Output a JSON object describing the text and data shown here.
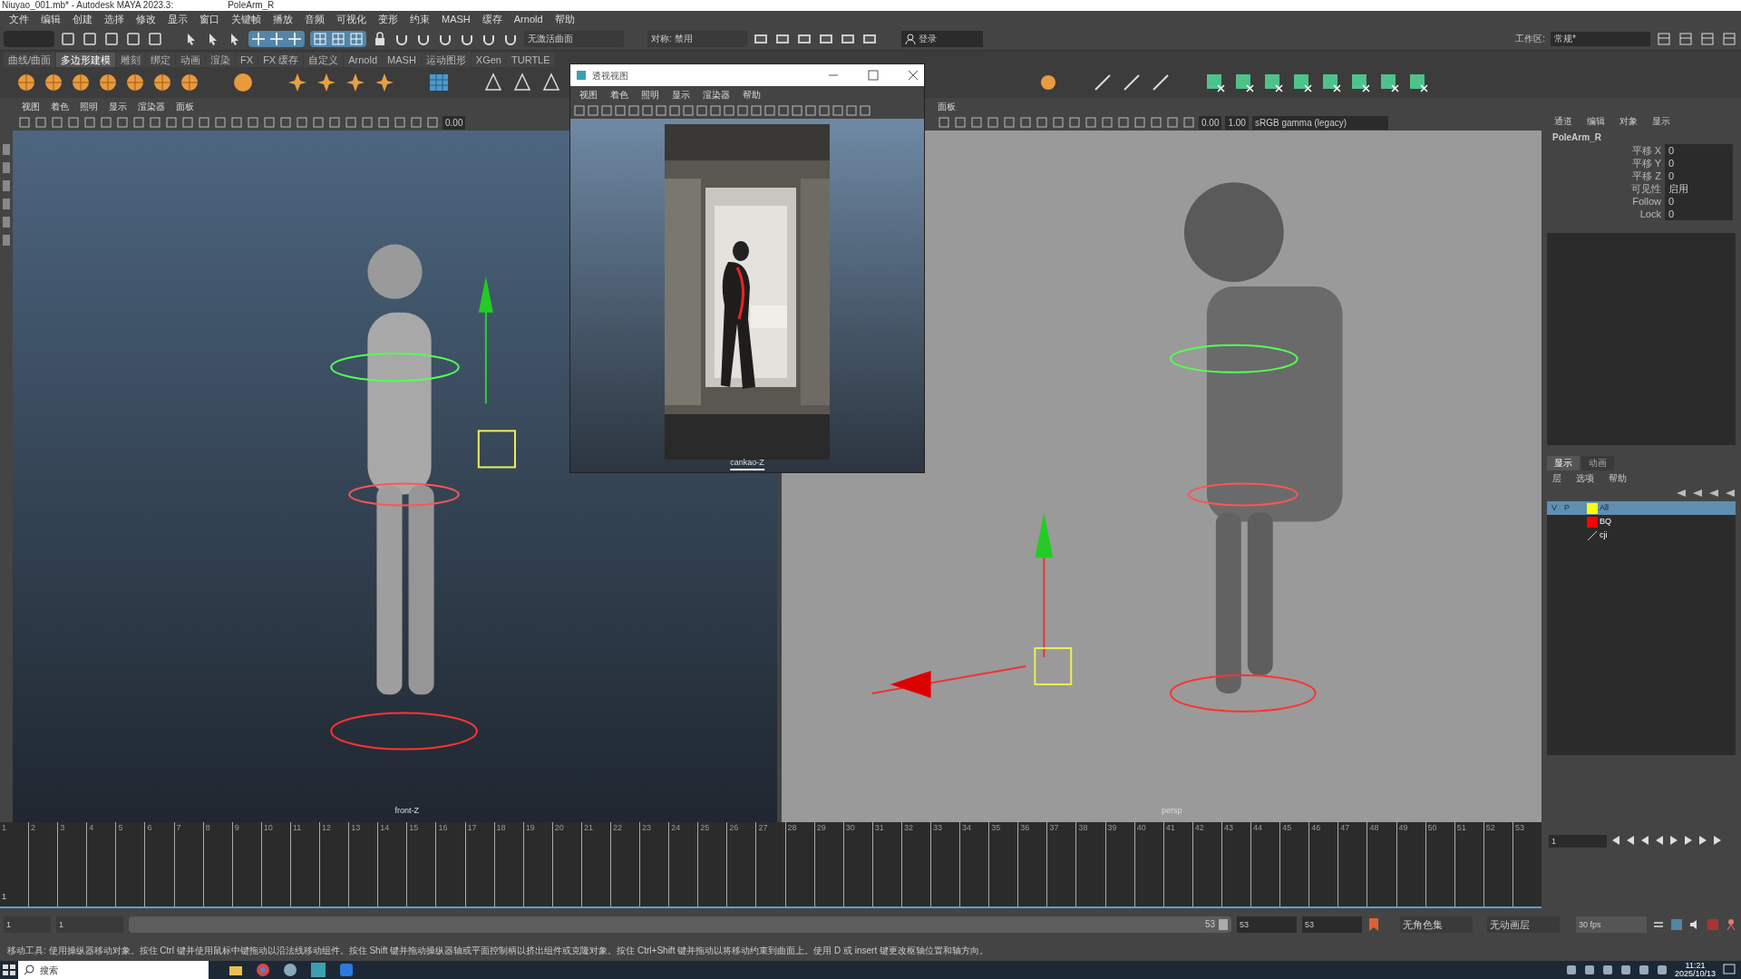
{
  "window": {
    "title": "Niuyao_001.mb* - Autodesk MAYA 2023.3:",
    "active_object": "PoleArm_R"
  },
  "menu": [
    "文件",
    "编辑",
    "创建",
    "选择",
    "修改",
    "显示",
    "窗口",
    "关键帧",
    "播放",
    "音频",
    "可视化",
    "变形",
    "约束",
    "MASH",
    "缓存",
    "Arnold",
    "帮助"
  ],
  "status_line": {
    "surface": "无激活曲面",
    "symmetry": "对称: 禁用",
    "login": "登录",
    "workspace_label": "工作区:",
    "workspace": "常规*"
  },
  "shelf_tabs": [
    {
      "label": "曲线/曲面",
      "selected": false
    },
    {
      "label": "多边形建模",
      "selected": true
    },
    {
      "label": "雕刻",
      "selected": false
    },
    {
      "label": "绑定",
      "selected": false
    },
    {
      "label": "动画",
      "selected": false
    },
    {
      "label": "渲染",
      "selected": false
    },
    {
      "label": "FX",
      "selected": false
    },
    {
      "label": "FX 缓存",
      "selected": false
    },
    {
      "label": "自定义",
      "selected": false
    },
    {
      "label": "Arnold",
      "selected": false
    },
    {
      "label": "MASH",
      "selected": false
    },
    {
      "label": "运动图形",
      "selected": false
    },
    {
      "label": "XGen",
      "selected": false
    },
    {
      "label": "TURTLE",
      "selected": false
    }
  ],
  "viewports": [
    {
      "menu": [
        "视图",
        "着色",
        "照明",
        "显示",
        "渲染器",
        "面板"
      ],
      "exposure": "0.00",
      "camera": "front-Z"
    },
    {
      "menu": [
        "面板"
      ],
      "exposure": "0.00",
      "gamma": "1.00",
      "color_space": "sRGB gamma (legacy)",
      "camera": "persp"
    }
  ],
  "floating_window": {
    "title": "透视视图",
    "menu": [
      "视图",
      "着色",
      "照明",
      "显示",
      "渲染器",
      "帮助"
    ],
    "camera": "cankao-Z"
  },
  "channel_box": {
    "menu": [
      "通道",
      "编辑",
      "对象",
      "显示"
    ],
    "object": "PoleArm_R",
    "attributes": [
      {
        "name": "平移 X",
        "value": "0"
      },
      {
        "name": "平移 Y",
        "value": "0"
      },
      {
        "name": "平移 Z",
        "value": "0"
      },
      {
        "name": "可见性",
        "value": "启用"
      },
      {
        "name": "Follow",
        "value": "0"
      },
      {
        "name": "Lock",
        "value": "0"
      }
    ]
  },
  "layer_editor": {
    "tabs": [
      {
        "label": "显示",
        "selected": true
      },
      {
        "label": "动画",
        "selected": false
      }
    ],
    "menu": [
      "层",
      "选项",
      "帮助"
    ],
    "layers": [
      {
        "name": "All",
        "color": "#ffff00",
        "selected": true,
        "flags": [
          "V",
          "P"
        ]
      },
      {
        "name": "BQ",
        "color": "#ff0000",
        "selected": false
      },
      {
        "name": "cji",
        "selected": false
      }
    ]
  },
  "timeline": {
    "ticks": [
      "1",
      "2",
      "3",
      "4",
      "5",
      "6",
      "7",
      "8",
      "9",
      "10",
      "11",
      "12",
      "13",
      "14",
      "15",
      "16",
      "17",
      "18",
      "19",
      "20",
      "21",
      "22",
      "23",
      "24",
      "25",
      "26",
      "27",
      "28",
      "29",
      "30",
      "31",
      "32",
      "33",
      "34",
      "35",
      "36",
      "37",
      "38",
      "39",
      "40",
      "41",
      "42",
      "43",
      "44",
      "45",
      "46",
      "47",
      "48",
      "49",
      "50",
      "51",
      "52",
      "53"
    ],
    "start_label": "1",
    "current_frame": "1"
  },
  "range": {
    "level": 1,
    "start": "1",
    "playback_start": "1",
    "slider_end": "53",
    "playback_end": "53",
    "end": "53",
    "character_set": "无角色集",
    "anim_layer": "无动画层",
    "fps": "30 fps"
  },
  "help_line": "移动工具: 使用操纵器移动对象。按住 Ctrl 键并使用鼠标中键拖动以沿法线移动组件。按住 Shift 键并拖动操纵器轴或平面控制柄以挤出组件或克隆对象。按住 Ctrl+Shift 键并拖动以将移动约束到曲面上。使用 D 或 insert 键更改枢轴位置和轴方向。",
  "taskbar": {
    "search": "搜索",
    "time": "11:21",
    "date": "2025/10/13"
  }
}
